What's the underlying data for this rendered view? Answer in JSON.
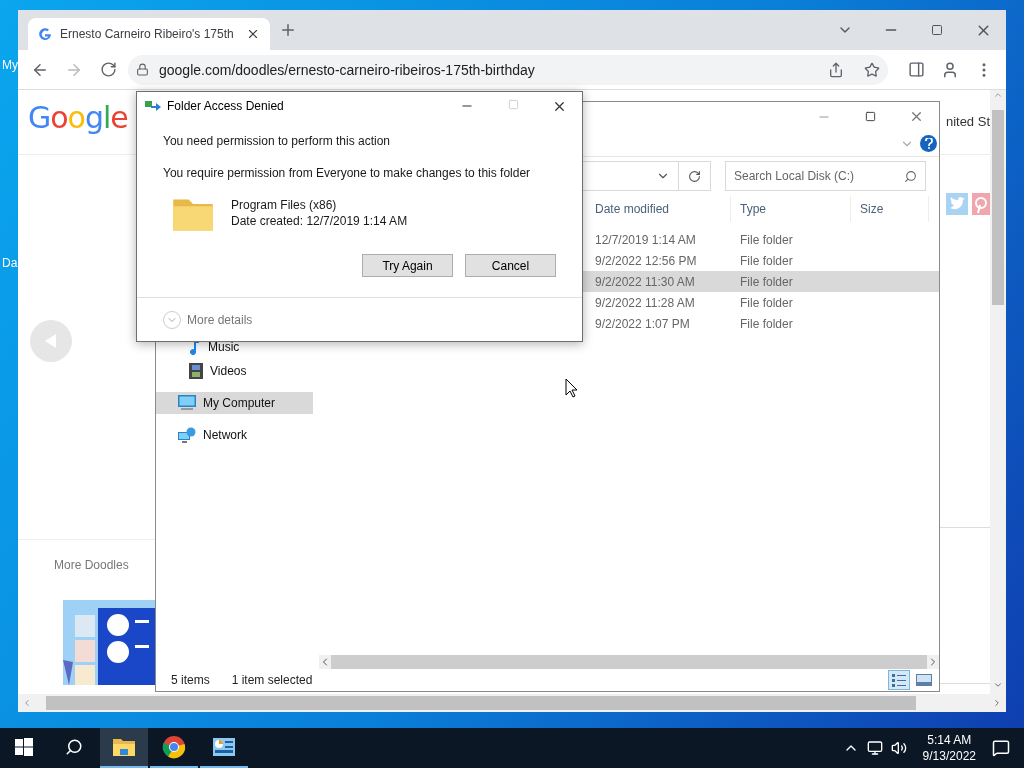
{
  "desktop": {
    "icon_labels": [
      "My",
      "Da"
    ]
  },
  "browser": {
    "tab": {
      "title": "Ernesto Carneiro Ribeiro's 175th",
      "selected": true
    },
    "url": "google.com/doodles/ernesto-carneiro-ribeiros-175th-birthday",
    "page": {
      "logo": "Google",
      "header_text": "nited St",
      "section_title": "More Doodles"
    }
  },
  "explorer": {
    "search": {
      "placeholder": "Search Local Disk (C:)"
    },
    "columns": [
      "Date modified",
      "Type",
      "Size"
    ],
    "rows": [
      {
        "date_modified": "12/7/2019 1:14 AM",
        "type": "File folder",
        "selected": false
      },
      {
        "date_modified": "9/2/2022 12:56 PM",
        "type": "File folder",
        "selected": false
      },
      {
        "date_modified": "9/2/2022 11:30 AM",
        "type": "File folder",
        "selected": true
      },
      {
        "date_modified": "9/2/2022 11:28 AM",
        "type": "File folder",
        "selected": false
      },
      {
        "date_modified": "9/2/2022 1:07 PM",
        "type": "File folder",
        "selected": false
      }
    ],
    "nav_items": [
      {
        "label": "Music",
        "kind": "music",
        "selected": false
      },
      {
        "label": "Videos",
        "kind": "videos",
        "selected": false
      },
      {
        "label": "My Computer",
        "kind": "computer",
        "selected": true
      },
      {
        "label": "Network",
        "kind": "network",
        "selected": false
      }
    ],
    "status": {
      "item_count": "5 items",
      "selection": "1 item selected"
    }
  },
  "dialog": {
    "title": "Folder Access Denied",
    "heading": "You need permission to perform this action",
    "message": "You require permission from Everyone to make changes to this folder",
    "folder": {
      "name": "Program Files (x86)",
      "date_created": "Date created: 12/7/2019 1:14 AM"
    },
    "buttons": [
      "Try Again",
      "Cancel"
    ],
    "details_toggle": {
      "label": "More details",
      "expanded": false
    }
  },
  "taskbar": {
    "apps": [
      {
        "kind": "explorer",
        "active": true
      },
      {
        "kind": "chrome",
        "active": false
      },
      {
        "kind": "app",
        "active": false
      }
    ],
    "clock": {
      "time": "5:14 AM",
      "date": "9/13/2022"
    }
  }
}
